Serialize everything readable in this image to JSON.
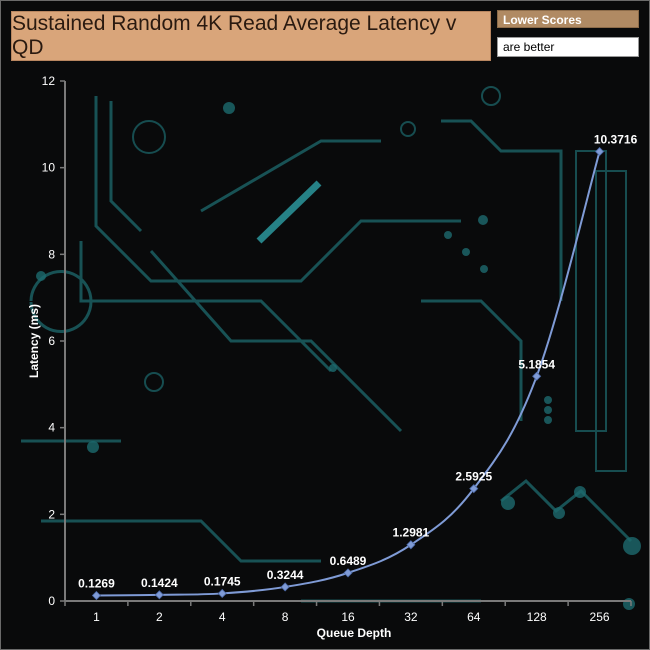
{
  "title": "Sustained Random 4K Read Average Latency v QD",
  "legend": {
    "line1": "Lower Scores",
    "line2": "are better"
  },
  "colors": {
    "series": "#7f9bd6",
    "title_bg": "#d9a57a",
    "legend_bg": "#b08a63",
    "axis": "#7a7a7a",
    "circuit": "#1f6f73"
  },
  "chart_data": {
    "type": "line",
    "title": "Sustained Random 4K Read Average Latency v QD",
    "xlabel": "Queue Depth",
    "ylabel": "Latency (ms)",
    "categories": [
      "1",
      "2",
      "4",
      "8",
      "16",
      "32",
      "64",
      "128",
      "256"
    ],
    "series": [
      {
        "values": [
          0.1269,
          0.1424,
          0.1745,
          0.3244,
          0.6489,
          1.2981,
          2.5925,
          5.1854,
          10.3716
        ],
        "labels": [
          "0.1269",
          "0.1424",
          "0.1745",
          "0.3244",
          "0.6489",
          "1.2981",
          "2.5925",
          "5.1854",
          "10.3716"
        ]
      }
    ],
    "ylim": [
      0,
      12
    ],
    "yticks": [
      "0",
      "2",
      "4",
      "6",
      "8",
      "10",
      "12"
    ],
    "grid": false,
    "legend_position": "top-right"
  }
}
